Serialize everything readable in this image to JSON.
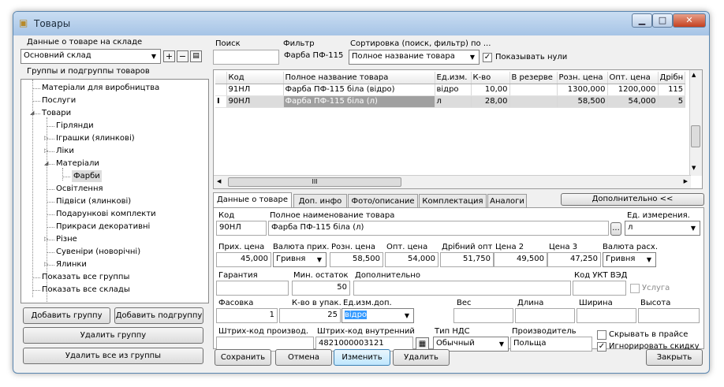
{
  "window": {
    "title": "Товары"
  },
  "left": {
    "warehouse_label": "Данные о товаре на складе",
    "warehouse_value": "Основний склад",
    "groups_label": "Группы и подгруппы товаров",
    "tree": [
      {
        "label": "Матеріали для виробництва",
        "expander": ""
      },
      {
        "label": "Послуги",
        "expander": ""
      },
      {
        "label": "Товари",
        "expander": "◢"
      },
      {
        "label": "Гірлянди",
        "expander": ""
      },
      {
        "label": "Іграшки (ялинкові)",
        "expander": "▷"
      },
      {
        "label": "Ліки",
        "expander": "▷"
      },
      {
        "label": "Матеріали",
        "expander": "◢"
      },
      {
        "label": "Фарби",
        "expander": ""
      },
      {
        "label": "Освітлення",
        "expander": ""
      },
      {
        "label": "Підвіси (ялинкові)",
        "expander": ""
      },
      {
        "label": "Подарункові комплекти",
        "expander": ""
      },
      {
        "label": "Прикраси декоративні",
        "expander": ""
      },
      {
        "label": "Різне",
        "expander": "▷"
      },
      {
        "label": "Сувеніри (новорічні)",
        "expander": ""
      },
      {
        "label": "Ялинки",
        "expander": "▷"
      },
      {
        "label": "Показать все группы",
        "expander": ""
      },
      {
        "label": "Показать все склады",
        "expander": ""
      }
    ],
    "btn_add_group": "Добавить группу",
    "btn_add_subgroup": "Добавить подгруппу",
    "btn_delete_group": "Удалить группу",
    "btn_delete_all": "Удалить все из группы"
  },
  "toolbar": {
    "search_label": "Поиск",
    "search_value": "",
    "filter_label": "Фильтр",
    "filter_value": "Фарба ПФ-115",
    "sort_label": "Сортировка (поиск, фильтр) по ...",
    "sort_value": "Полное название товара",
    "show_zero_label": "Показывать нули"
  },
  "table": {
    "headers": [
      "Код",
      "Полное название товара",
      "Ед.изм.",
      "К-во",
      "В резерве",
      "Розн. цена",
      "Опт. цена",
      "Дрібн"
    ],
    "rows": [
      [
        "91НЛ",
        "Фарба ПФ-115 біла (відро)",
        "відро",
        "10,00",
        "",
        "1300,000",
        "1200,000",
        "115"
      ],
      [
        "90НЛ",
        "Фарба ПФ-115 біла (л)",
        "л",
        "28,00",
        "",
        "58,500",
        "54,000",
        "5"
      ]
    ],
    "hscroll_grip": "III"
  },
  "tabs": [
    "Данные о товаре",
    "Доп. инфо",
    "Фото/описание",
    "Комплектация",
    "Аналоги"
  ],
  "more_button": "Дополнительно <<",
  "form": {
    "code_label": "Код",
    "code": "90НЛ",
    "name_label": "Полное наименование товара",
    "name": "Фарба ПФ-115 біла (л)",
    "unit_label": "Ед. измерения.",
    "unit": "л",
    "ellipsis": "...",
    "buy_price_label": "Прих. цена",
    "buy_price": "45,000",
    "buy_currency_label": "Валюта прих.",
    "buy_currency": "Гривня",
    "retail_label": "Розн. цена",
    "retail": "58,500",
    "wholesale_label": "Опт. цена",
    "wholesale": "54,000",
    "small_label": "Дрібний опт",
    "small": "51,750",
    "price2_label": "Цена 2",
    "price2": "49,500",
    "price3_label": "Цена 3",
    "price3": "47,250",
    "sell_currency_label": "Валюта расх.",
    "sell_currency": "Гривня",
    "warranty_label": "Гарантия",
    "warranty": "",
    "min_label": "Мин. остаток",
    "min": "50",
    "extra_label": "Дополнительно",
    "extra": "",
    "ukt_label": "Код УКТ ВЭД",
    "ukt": "",
    "service_label": "Услуга",
    "pack_label": "Фасовка",
    "pack": "1",
    "qty_pack_label": "К-во в упак.",
    "qty_pack": "25",
    "unit_add_label": "Ед.изм.доп.",
    "unit_add": "відро",
    "weight_label": "Вес",
    "length_label": "Длина",
    "width_label": "Ширина",
    "height_label": "Высота",
    "barcode_prod_label": "Штрих-код производ.",
    "barcode_prod": "",
    "barcode_int_label": "Штрих-код внутренний",
    "barcode_int": "4821000003121",
    "vat_label": "Тип НДС",
    "vat": "Обычный",
    "maker_label": "Производитель",
    "maker": "Польща",
    "hide_price_label": "Скрывать в прайсе",
    "ignore_disc_label": "Игнорировать скидку"
  },
  "bottom": {
    "save": "Сохранить",
    "cancel": "Отмена",
    "change": "Изменить",
    "delete": "Удалить",
    "close": "Закрыть"
  }
}
